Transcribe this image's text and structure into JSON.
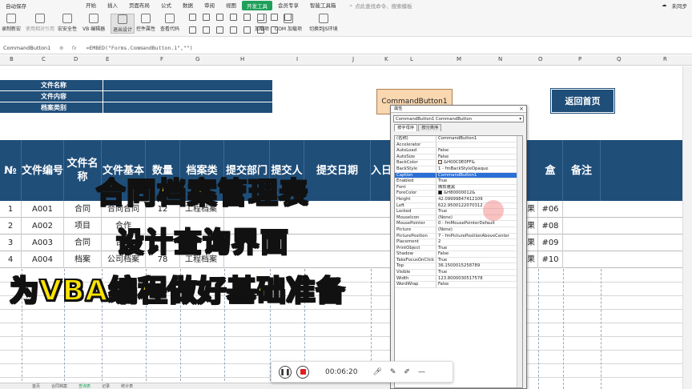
{
  "menubar": {
    "autosave": "自动保存",
    "items": [
      "开始",
      "插入",
      "页面布局",
      "公式",
      "数据",
      "审阅",
      "视图",
      "开发工具",
      "会员专享",
      "智能工具箱"
    ],
    "active": "开发工具",
    "search_placeholder": "点此查找命令、搜索模板",
    "right_label": "未同步"
  },
  "ribbon": {
    "buttons": [
      "录制新宏",
      "使用相对引用",
      "宏安全性",
      "VB 编辑器",
      "退出设计",
      "控件属性",
      "查看代码",
      "加载项",
      "COM 加载项",
      "切换到JS环境"
    ]
  },
  "formula_bar": {
    "name_box": "CommandButton1",
    "fx": "fx",
    "formula": "=EMBED(\"Forms.CommandButton.1\",\"\")"
  },
  "columns": [
    "B",
    "C",
    "D",
    "E",
    "F",
    "G",
    "H",
    "I",
    "J",
    "K",
    "L",
    "M",
    "N",
    "O",
    "P",
    "Q",
    "R"
  ],
  "info_block": {
    "rows": [
      "文件名称",
      "文件内容",
      "档案类别"
    ]
  },
  "sheet_buttons": {
    "command_button": "CommandButton1",
    "back_button": "返回首页"
  },
  "table": {
    "headers": [
      "№",
      "文件编号",
      "文件名称",
      "文件基本",
      "数量",
      "档案类",
      "提交部门",
      "提交人",
      "提交日期",
      "入日",
      "盒",
      "备注"
    ],
    "rows": [
      {
        "no": "1",
        "code": "A001",
        "name": "合同",
        "basic": "合同合同",
        "qty": "12",
        "type": "工程档案",
        "box": "#06",
        "tail": "果"
      },
      {
        "no": "2",
        "code": "A002",
        "name": "项目",
        "basic": "合作",
        "qty": "",
        "type": "",
        "box": "#08",
        "tail": "果"
      },
      {
        "no": "3",
        "code": "A003",
        "name": "合同",
        "basic": "合作",
        "qty": "",
        "type": "",
        "box": "#09",
        "tail": "果"
      },
      {
        "no": "4",
        "code": "A004",
        "name": "档案",
        "basic": "公司档案",
        "qty": "78",
        "type": "工程档案",
        "box": "#10",
        "tail": "果"
      }
    ]
  },
  "overlay": {
    "line1": "合同档案管理表",
    "line2": "设计查询界面",
    "line3": "为VBA编程做好基础准备"
  },
  "properties": {
    "title": "属性",
    "close": "×",
    "object": "CommandButton1 CommandButton",
    "tabs": [
      "按字母序",
      "按分类序"
    ],
    "rows": [
      {
        "n": "(名称)",
        "v": "CommandButton1"
      },
      {
        "n": "Accelerator",
        "v": ""
      },
      {
        "n": "AutoLoad",
        "v": "False"
      },
      {
        "n": "AutoSize",
        "v": "False"
      },
      {
        "n": "BackColor",
        "v": "&H00C0E0FF&",
        "swatch": "#ffe0c0"
      },
      {
        "n": "BackStyle",
        "v": "1 - fmBackStyleOpaque"
      },
      {
        "n": "Caption",
        "v": "CommandButton1",
        "hl": true
      },
      {
        "n": "Enabled",
        "v": "True"
      },
      {
        "n": "Font",
        "v": "微软雅黑"
      },
      {
        "n": "ForeColor",
        "v": "&H80000012&",
        "swatch": "#000000"
      },
      {
        "n": "Height",
        "v": "42.09999847412109"
      },
      {
        "n": "Left",
        "v": "622.9500122070312"
      },
      {
        "n": "Locked",
        "v": "True"
      },
      {
        "n": "MouseIcon",
        "v": "(None)"
      },
      {
        "n": "MousePointer",
        "v": "0 - fmMousePointerDefault"
      },
      {
        "n": "Picture",
        "v": "(None)"
      },
      {
        "n": "PicturePosition",
        "v": "7 - fmPicturePositionAboveCenter"
      },
      {
        "n": "Placement",
        "v": "2"
      },
      {
        "n": "PrintObject",
        "v": "True"
      },
      {
        "n": "Shadow",
        "v": "False"
      },
      {
        "n": "TakeFocusOnClick",
        "v": "True"
      },
      {
        "n": "Top",
        "v": "36.1500015258789"
      },
      {
        "n": "Visible",
        "v": "True"
      },
      {
        "n": "Width",
        "v": "123.8000030517578"
      },
      {
        "n": "WordWrap",
        "v": "False"
      }
    ]
  },
  "recorder": {
    "time": "00:06:20"
  },
  "sheet_tabs": [
    "首页",
    "合同档案",
    "查询表",
    "记录",
    "统计表"
  ],
  "colors": {
    "header_blue": "#1f4e79",
    "overlay_yellow": "#fce300",
    "devtab_green": "#1fa05a"
  }
}
